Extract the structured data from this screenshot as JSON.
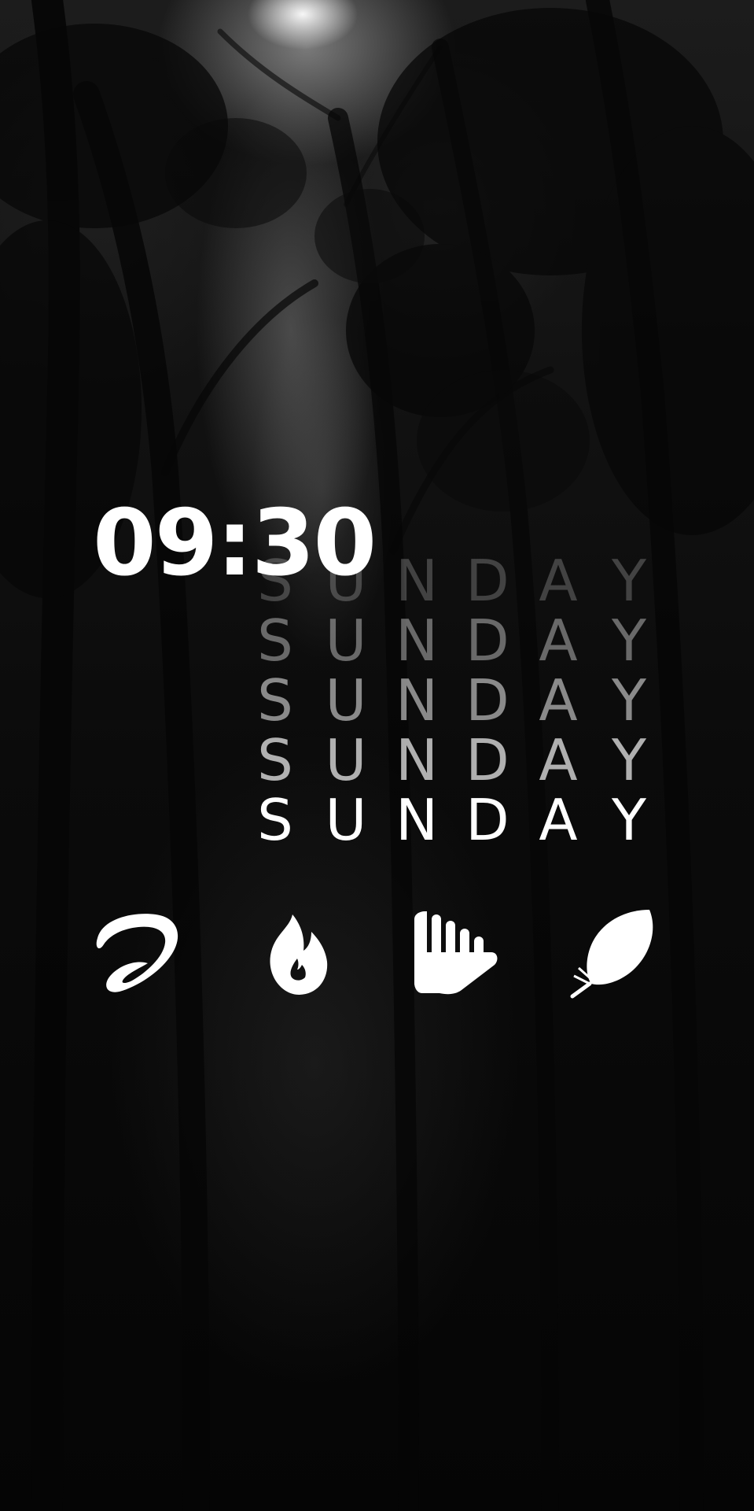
{
  "clock": {
    "time": "09:30"
  },
  "day": {
    "letters": [
      "S",
      "U",
      "N",
      "D",
      "A",
      "Y"
    ]
  },
  "apps": [
    {
      "icon": "airtel-icon"
    },
    {
      "icon": "tinder-icon"
    },
    {
      "icon": "deezer-icon"
    },
    {
      "icon": "feather-icon"
    }
  ],
  "colors": {
    "foreground": "#ffffff",
    "background": "#000000"
  }
}
